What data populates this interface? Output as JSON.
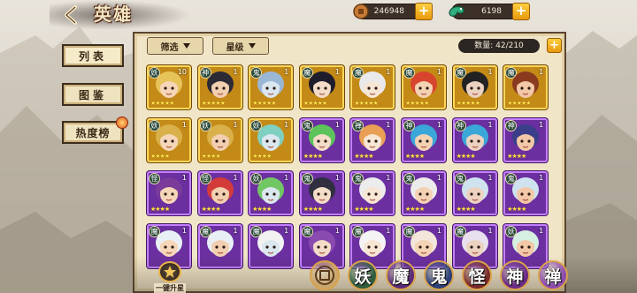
{
  "header": {
    "title": "英雄",
    "gold_amount": "246948",
    "jade_amount": "6198"
  },
  "side_tabs": [
    {
      "label": "列表",
      "hot": false
    },
    {
      "label": "图鉴",
      "hot": false
    },
    {
      "label": "热度榜",
      "hot": true
    }
  ],
  "toolbar": {
    "filter_label": "筛选",
    "star_label": "星级",
    "count_text": "数量: 42/210"
  },
  "heroes": [
    {
      "type": "妖",
      "level": "10",
      "rarity": "gold",
      "stars": "★★★★★"
    },
    {
      "type": "神",
      "level": "1",
      "rarity": "gold",
      "stars": "★★★★★"
    },
    {
      "type": "鬼",
      "level": "1",
      "rarity": "gold",
      "stars": "★★★★★"
    },
    {
      "type": "魔",
      "level": "1",
      "rarity": "gold",
      "stars": "★★★★★"
    },
    {
      "type": "魔",
      "level": "1",
      "rarity": "gold",
      "stars": "★★★★★"
    },
    {
      "type": "魔",
      "level": "1",
      "rarity": "gold",
      "stars": "★★★★★"
    },
    {
      "type": "魔",
      "level": "1",
      "rarity": "gold",
      "stars": "★★★★★"
    },
    {
      "type": "魔",
      "level": "1",
      "rarity": "gold",
      "stars": "★★★★★"
    },
    {
      "type": "妖",
      "level": "1",
      "rarity": "gold",
      "stars": "★★★★"
    },
    {
      "type": "妖",
      "level": "1",
      "rarity": "gold",
      "stars": "★★★★"
    },
    {
      "type": "妖",
      "level": "1",
      "rarity": "gold",
      "stars": "★★★★"
    },
    {
      "type": "鬼",
      "level": "1",
      "rarity": "purple",
      "stars": "★★★★"
    },
    {
      "type": "禅",
      "level": "1",
      "rarity": "purple",
      "stars": "★★★★"
    },
    {
      "type": "神",
      "level": "1",
      "rarity": "purple",
      "stars": "★★★★"
    },
    {
      "type": "神",
      "level": "1",
      "rarity": "purple",
      "stars": "★★★★"
    },
    {
      "type": "神",
      "level": "1",
      "rarity": "purple",
      "stars": "★★★★"
    },
    {
      "type": "怪",
      "level": "1",
      "rarity": "purple",
      "stars": "★★★★"
    },
    {
      "type": "怪",
      "level": "1",
      "rarity": "purple",
      "stars": "★★★★"
    },
    {
      "type": "妖",
      "level": "1",
      "rarity": "purple",
      "stars": "★★★★"
    },
    {
      "type": "鬼",
      "level": "1",
      "rarity": "purple",
      "stars": "★★★★"
    },
    {
      "type": "鬼",
      "level": "1",
      "rarity": "purple",
      "stars": "★★★★"
    },
    {
      "type": "鬼",
      "level": "1",
      "rarity": "purple",
      "stars": "★★★★"
    },
    {
      "type": "鬼",
      "level": "1",
      "rarity": "purple",
      "stars": "★★★★"
    },
    {
      "type": "鬼",
      "level": "1",
      "rarity": "purple",
      "stars": "★★★★"
    },
    {
      "type": "魔",
      "level": "1",
      "rarity": "purple",
      "stars": ""
    },
    {
      "type": "魔",
      "level": "1",
      "rarity": "purple",
      "stars": ""
    },
    {
      "type": "魔",
      "level": "1",
      "rarity": "purple",
      "stars": ""
    },
    {
      "type": "魔",
      "level": "1",
      "rarity": "purple",
      "stars": ""
    },
    {
      "type": "魔",
      "level": "1",
      "rarity": "purple",
      "stars": ""
    },
    {
      "type": "魔",
      "level": "1",
      "rarity": "purple",
      "stars": ""
    },
    {
      "type": "魔",
      "level": "1",
      "rarity": "purple",
      "stars": ""
    },
    {
      "type": "妖",
      "level": "1",
      "rarity": "purple",
      "stars": ""
    }
  ],
  "bottom": {
    "upgrade_label": "一键升星",
    "type_filters": [
      {
        "label": "",
        "name": "all",
        "color": "#c9a66b"
      },
      {
        "label": "妖",
        "name": "yao",
        "color": "#2f5d3f"
      },
      {
        "label": "魔",
        "name": "mo",
        "color": "#5a2a78"
      },
      {
        "label": "鬼",
        "name": "gui",
        "color": "#2c3f78"
      },
      {
        "label": "怪",
        "name": "guai",
        "color": "#7a2a2a"
      },
      {
        "label": "神",
        "name": "shen",
        "color": "#6a2b86"
      },
      {
        "label": "禅",
        "name": "chan",
        "color": "#8c4db0"
      }
    ]
  },
  "colors": {
    "gold_frame": "#ffd75a",
    "purple_frame": "#c480ff",
    "accent_orange": "#f0a21a"
  },
  "icons": {
    "back": "chevron-left-icon",
    "gold": "coin-icon",
    "jade": "jade-icon",
    "plus": "plus-icon",
    "upgrade": "star-up-icon"
  }
}
